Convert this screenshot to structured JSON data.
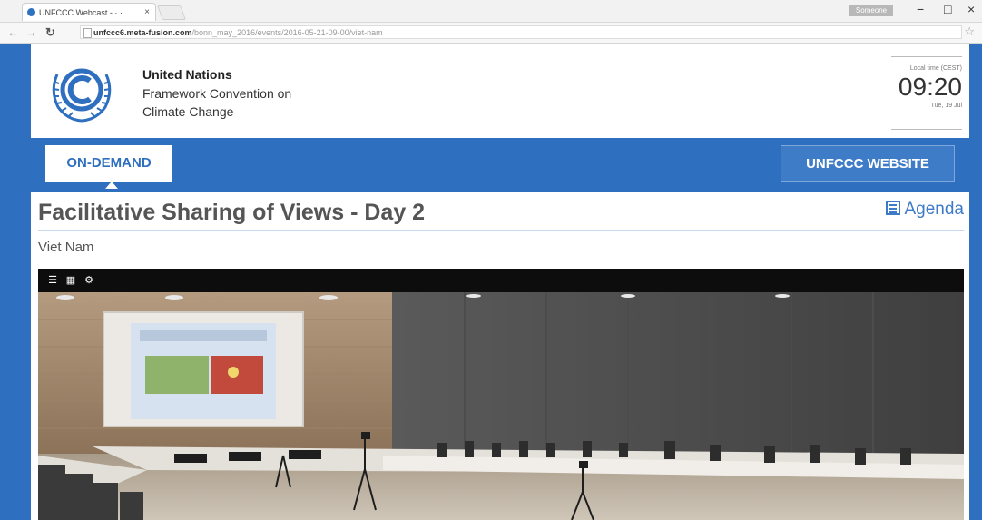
{
  "browser": {
    "tab_title": "UNFCCC Webcast - · ·",
    "tab_close": "×",
    "user_label": "Someone",
    "window_controls": {
      "minimize": "−",
      "maximize": "□",
      "close": "×"
    },
    "url_domain": "unfccc6.meta-fusion.com",
    "url_path": "/bonn_may_2016/events/2016-05-21-09-00/viet-nam",
    "icons": [
      "back-icon",
      "forward-icon",
      "reload-icon",
      "page-icon",
      "star-icon"
    ]
  },
  "header": {
    "org_line1": "United Nations",
    "org_line2": "Framework Convention on",
    "org_line3": "Climate Change",
    "clock_label": "Local time (CEST)",
    "clock_time": "09:20",
    "clock_date": "Tue, 19 Jul"
  },
  "nav": {
    "on_demand": "ON-DEMAND",
    "website": "UNFCCC WEBSITE"
  },
  "event": {
    "title": "Facilitative Sharing of Views - Day 2",
    "subtitle": "Viet Nam",
    "agenda_label": "Agenda"
  },
  "player": {
    "controls": [
      "list-icon",
      "grid-icon",
      "settings-icon"
    ]
  },
  "colors": {
    "brand_blue": "#2f6fbf",
    "link_blue": "#3d7ac7",
    "title_gray": "#555555"
  }
}
